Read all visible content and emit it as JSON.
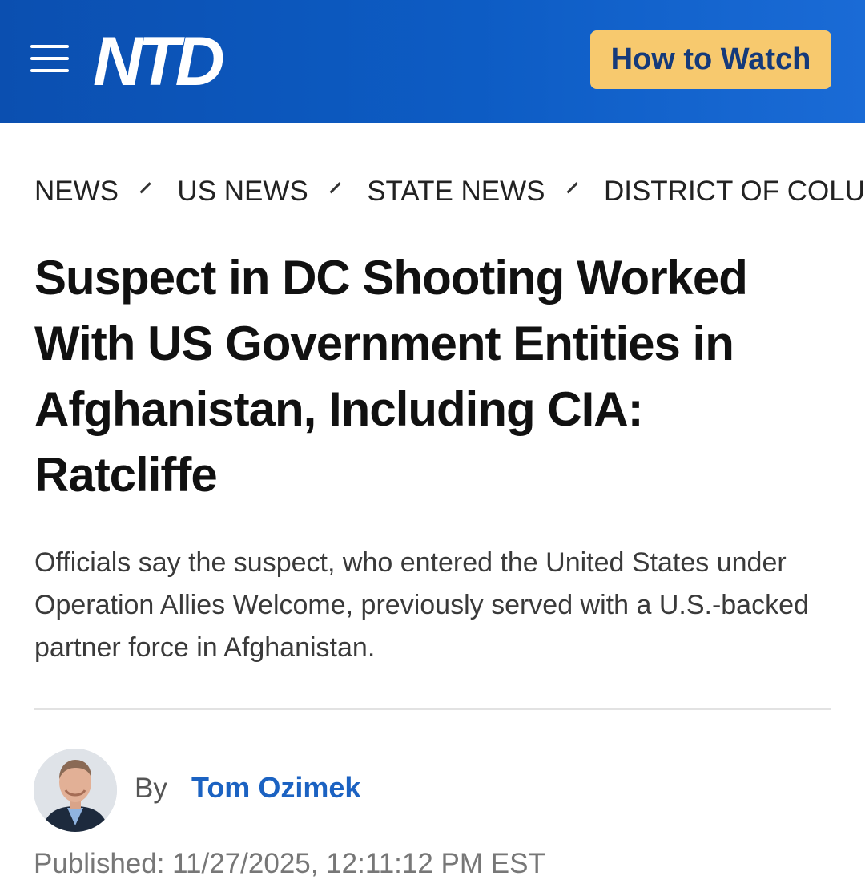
{
  "header": {
    "logo_text": "NTD",
    "how_to_watch_label": "How to Watch",
    "brand_color": "#0d5cc4",
    "button_color": "#f7c96e"
  },
  "breadcrumb": [
    "NEWS",
    "US NEWS",
    "STATE NEWS",
    "DISTRICT OF COLU"
  ],
  "article": {
    "title": "Suspect in DC Shooting Worked With US Government Entities in Afghanistan, Including CIA: Ratcliffe",
    "summary": "Officials say the suspect, who entered the United States under Operation Allies Welcome, previously served with a U.S.-backed partner force in Afghanistan.",
    "byline_prefix": "By",
    "author": "Tom Ozimek",
    "published": "Published: 11/27/2025, 12:11:12 PM EST"
  },
  "icons": {
    "menu": "menu-icon",
    "breadcrumb_separator": "chevron-right-icon"
  }
}
